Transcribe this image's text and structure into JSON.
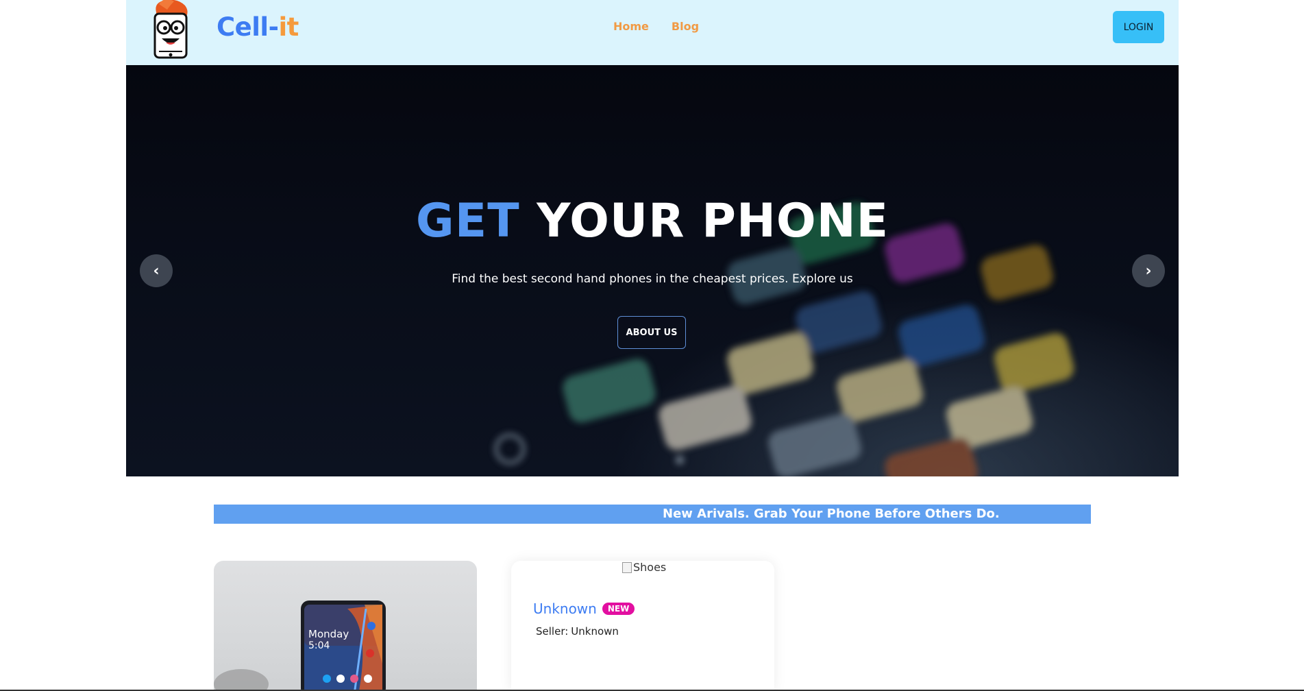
{
  "header": {
    "brand_part1": "Cell-",
    "brand_part2": "it",
    "nav": [
      {
        "label": "Home"
      },
      {
        "label": "Blog"
      }
    ],
    "login_label": "LOGIN",
    "logo_icon": "nerd-phone-mascot-icon",
    "colors": {
      "background": "#dbf4fd",
      "brand_blue": "#3d7cf2",
      "brand_orange": "#f59a3c",
      "login_bg": "#37bff7"
    }
  },
  "hero": {
    "title_accent": "GET",
    "title_rest": "YOUR PHONE",
    "subtitle": "Find the best second hand phones in the cheapest prices. Explore us",
    "cta_label": "ABOUT US",
    "prev_icon": "‹",
    "next_icon": "›",
    "colors": {
      "accent": "#5596f0"
    }
  },
  "marquee": {
    "text": "New Arivals. Grab Your Phone Before Others Do.",
    "color": "#60a0f0"
  },
  "cards": [
    {
      "image": "phone-photo",
      "phone_screen_day": "Monday",
      "phone_screen_time": "5:04"
    },
    {
      "image_alt": "Shoes",
      "title": "Unknown",
      "badge": "NEW",
      "seller_label": "Seller:",
      "seller_name": "Unknown",
      "colors": {
        "title": "#3d7cf2",
        "badge": "#e20fa0"
      }
    }
  ]
}
